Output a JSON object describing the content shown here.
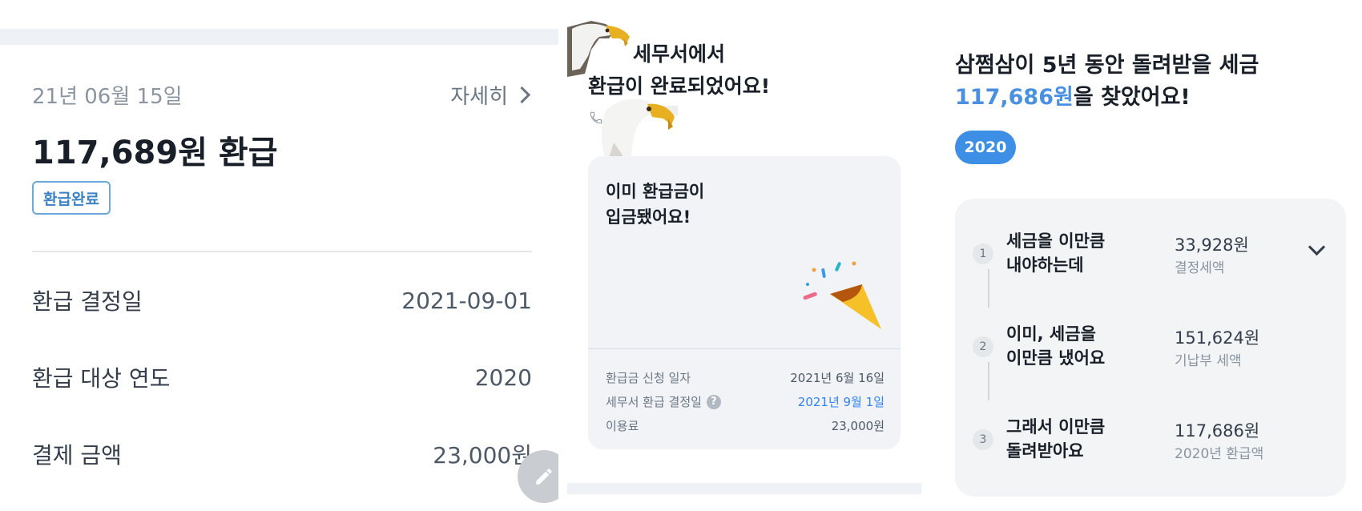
{
  "panel1": {
    "date": "21년 06월 15일",
    "detail_link": "자세히",
    "refund_amount": "117,689원 환급",
    "status_badge": "환급완료",
    "rows": [
      {
        "label": "환급 결정일",
        "value": "2021-09-01"
      },
      {
        "label": "환급 대상 연도",
        "value": "2020"
      },
      {
        "label": "결제 금액",
        "value": "23,000원"
      }
    ],
    "fab_icon": "pencil-icon"
  },
  "panel2": {
    "title_line1": "세무서에서",
    "title_line2": "환급이 완료되었어요!",
    "card": {
      "message_line1": "이미 환급금이",
      "message_line2": "입금됐어요!",
      "illustration": "party-popper-icon",
      "info": [
        {
          "label": "환급금 신청 일자",
          "value": "2021년 6월 16일"
        },
        {
          "label": "세무서 환급 결정일",
          "value": "2021년 9월 1일",
          "help": "?"
        },
        {
          "label": "이용료",
          "value": "23,000원"
        }
      ]
    },
    "accent": "#3182f6"
  },
  "panel3": {
    "heading_line1": "삼쩜삼이 5년 동안 돌려받을 세금",
    "heading_amount": "117,686원",
    "heading_suffix": "을 찾았어요!",
    "year_chip": "2020",
    "steps": [
      {
        "num": "1",
        "title_line1": "세금을 이만큼",
        "title_line2": "내야하는데",
        "value": "33,928원",
        "sub": "결정세액"
      },
      {
        "num": "2",
        "title_line1": "이미, 세금을",
        "title_line2": "이만큼 냈어요",
        "value": "151,624원",
        "sub": "기납부 세액"
      },
      {
        "num": "3",
        "title_line1": "그래서 이만큼",
        "title_line2": "돌려받아요",
        "value": "117,686원",
        "sub": "2020년 환급액"
      }
    ],
    "accent": "#4a90e2"
  }
}
